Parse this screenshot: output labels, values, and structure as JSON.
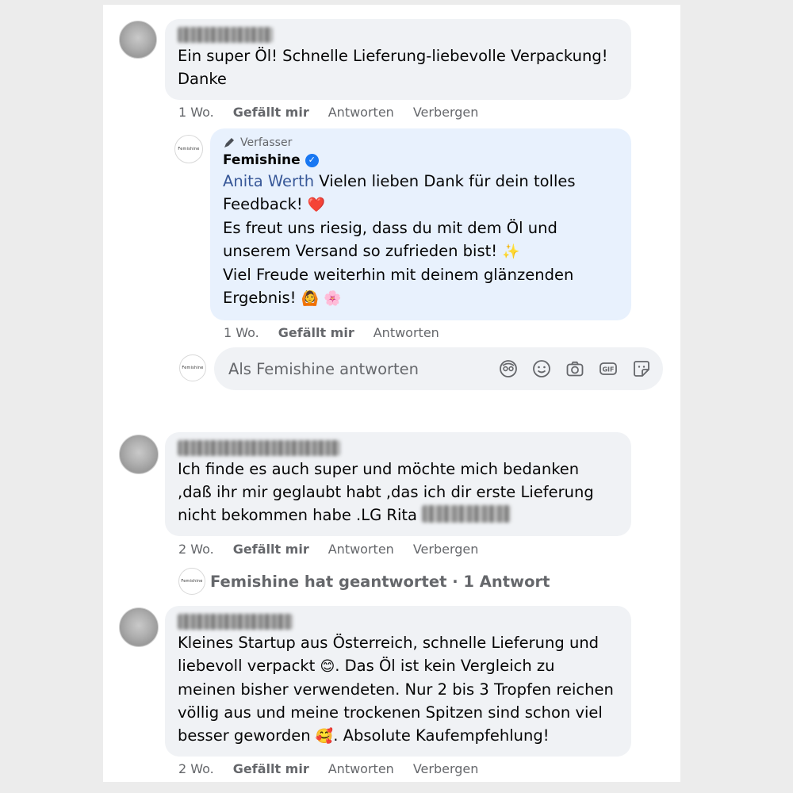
{
  "comments": [
    {
      "text_lines": [
        "Ein super Öl! Schnelle Lieferung-liebevolle Verpackung!",
        "Danke"
      ],
      "time": "1 Wo.",
      "like": "Gefällt mir",
      "reply": "Antworten",
      "hide": "Verbergen"
    },
    {
      "text_lines": [
        "Ich finde es auch super und möchte mich bedanken",
        ",daß ihr mir geglaubt habt ,das ich dir erste Lieferung",
        "nicht bekommen habe .LG Rita"
      ],
      "time": "2 Wo.",
      "like": "Gefällt mir",
      "reply": "Antworten",
      "hide": "Verbergen"
    },
    {
      "text_lines": [
        "Kleines Startup aus Österreich, schnelle Lieferung und",
        "liebevoll verpackt",
        ". Das Öl ist kein Vergleich zu",
        "meinen bisher verwendeten. Nur 2 bis 3 Tropfen reichen",
        "völlig aus und meine trockenen Spitzen sind schon viel",
        "besser geworden",
        ". Absolute Kaufempfehlung!"
      ],
      "emojis": [
        "😊",
        "🥰"
      ],
      "time": "2 Wo.",
      "like": "Gefällt mir",
      "reply": "Antworten",
      "hide": "Verbergen"
    }
  ],
  "author_reply": {
    "tag": "Verfasser",
    "name": "Femishine",
    "mention": "Anita Werth",
    "lines": [
      " Vielen lieben Dank für dein tolles",
      "Feedback!",
      "Es freut uns riesig, dass du mit dem Öl und",
      "unserem Versand so zufrieden bist!",
      "Viel Freude weiterhin mit deinem glänzenden",
      "Ergebnis!"
    ],
    "emojis": [
      "❤️",
      "✨",
      "🙆",
      "🌸"
    ],
    "time": "1 Wo.",
    "like": "Gefällt mir",
    "reply": "Antworten"
  },
  "reply_input": {
    "placeholder": "Als Femishine antworten",
    "icons": [
      "avatar-sticker-icon",
      "emoji-icon",
      "camera-icon",
      "gif-icon",
      "sticker-icon"
    ]
  },
  "replied_summary": "Femishine hat geantwortet · 1 Antwort",
  "brand_logo_text": "Femishine",
  "colors": {
    "author_bubble": "#e8f1fd",
    "bubble": "#f0f2f5",
    "mention": "#385898",
    "badge": "#1877f2"
  }
}
